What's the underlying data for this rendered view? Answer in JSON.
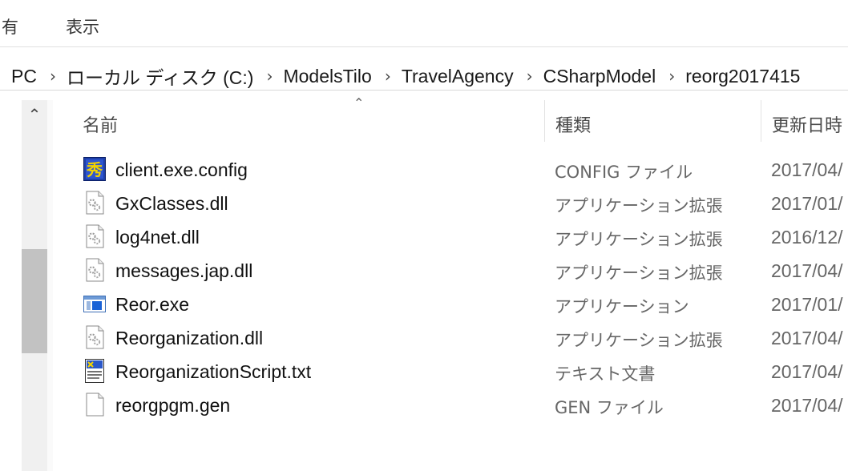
{
  "ribbon": {
    "tab_share": "有",
    "tab_view": "表示"
  },
  "address_bar": {
    "crumbs": [
      "PC",
      "ローカル ディスク (C:)",
      "ModelsTilo",
      "TravelAgency",
      "CSharpModel",
      "reorg2017415"
    ],
    "separator": "›"
  },
  "columns": {
    "name": "名前",
    "type": "種類",
    "modified": "更新日時"
  },
  "files": [
    {
      "name": "client.exe.config",
      "type": "CONFIG ファイル",
      "modified": "2017/04/",
      "icon": "config-file-icon"
    },
    {
      "name": "GxClasses.dll",
      "type": "アプリケーション拡張",
      "modified": "2017/01/",
      "icon": "dll-gear-icon"
    },
    {
      "name": "log4net.dll",
      "type": "アプリケーション拡張",
      "modified": "2016/12/",
      "icon": "dll-gear-icon"
    },
    {
      "name": "messages.jap.dll",
      "type": "アプリケーション拡張",
      "modified": "2017/04/",
      "icon": "dll-gear-icon"
    },
    {
      "name": "Reor.exe",
      "type": "アプリケーション",
      "modified": "2017/01/",
      "icon": "exe-window-icon"
    },
    {
      "name": "Reorganization.dll",
      "type": "アプリケーション拡張",
      "modified": "2017/04/",
      "icon": "dll-gear-icon"
    },
    {
      "name": "ReorganizationScript.txt",
      "type": "テキスト文書",
      "modified": "2017/04/",
      "icon": "text-document-icon"
    },
    {
      "name": "reorgpgm.gen",
      "type": "GEN ファイル",
      "modified": "2017/04/",
      "icon": "blank-file-icon"
    }
  ]
}
